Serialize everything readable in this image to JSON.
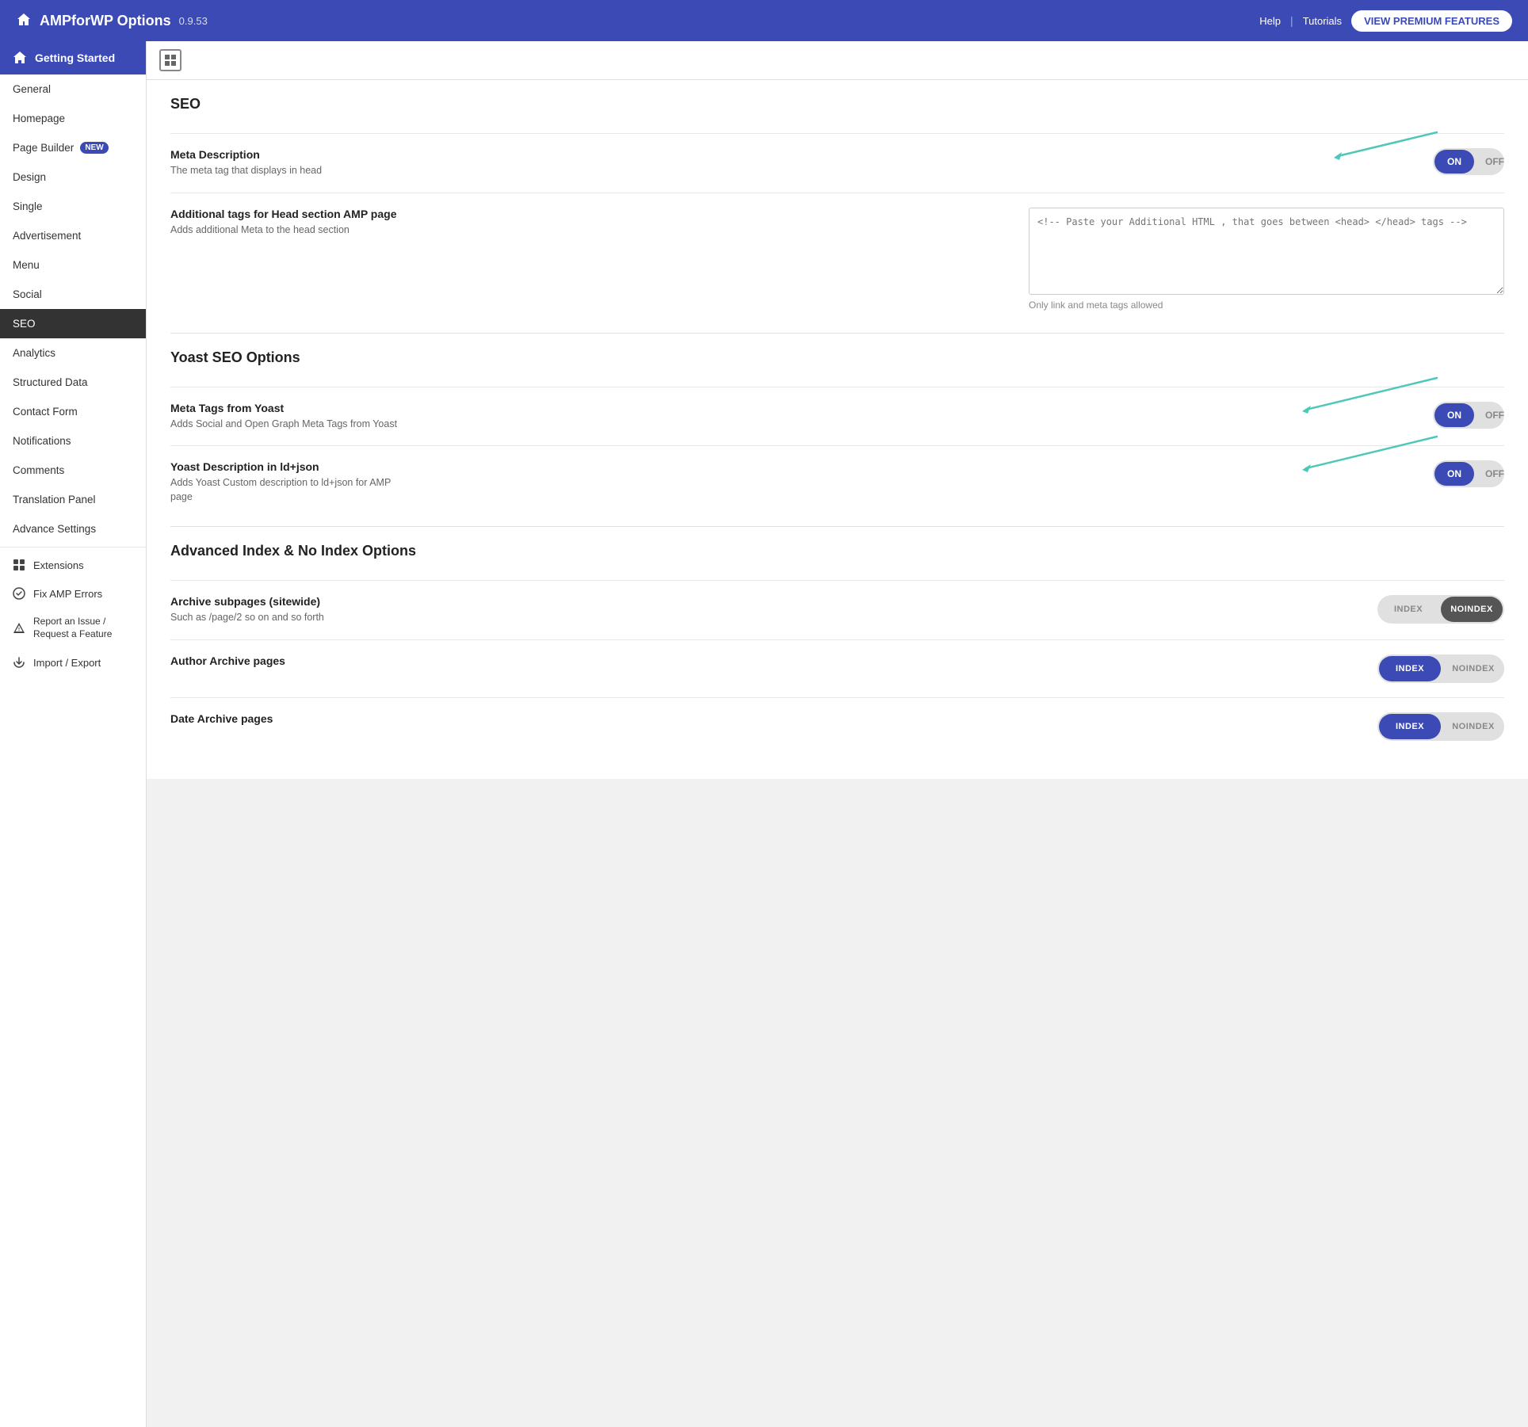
{
  "header": {
    "title": "AMPforWP Options",
    "version": "0.9.53",
    "help_label": "Help",
    "tutorials_label": "Tutorials",
    "premium_btn": "VIEW PREMIUM FEATURES"
  },
  "sidebar": {
    "getting_started": "Getting Started",
    "items": [
      {
        "label": "General",
        "id": "general",
        "active": false
      },
      {
        "label": "Homepage",
        "id": "homepage",
        "active": false
      },
      {
        "label": "Page Builder",
        "id": "page-builder",
        "active": false,
        "badge": "NEW"
      },
      {
        "label": "Design",
        "id": "design",
        "active": false
      },
      {
        "label": "Single",
        "id": "single",
        "active": false
      },
      {
        "label": "Advertisement",
        "id": "advertisement",
        "active": false
      },
      {
        "label": "Menu",
        "id": "menu",
        "active": false
      },
      {
        "label": "Social",
        "id": "social",
        "active": false
      },
      {
        "label": "SEO",
        "id": "seo",
        "active": true
      },
      {
        "label": "Analytics",
        "id": "analytics",
        "active": false
      },
      {
        "label": "Structured Data",
        "id": "structured-data",
        "active": false
      },
      {
        "label": "Contact Form",
        "id": "contact-form",
        "active": false
      },
      {
        "label": "Notifications",
        "id": "notifications",
        "active": false
      },
      {
        "label": "Comments",
        "id": "comments",
        "active": false
      },
      {
        "label": "Translation Panel",
        "id": "translation-panel",
        "active": false
      },
      {
        "label": "Advance Settings",
        "id": "advance-settings",
        "active": false
      }
    ],
    "extensions_label": "Extensions",
    "fix_amp_label": "Fix AMP Errors",
    "report_label": "Report an Issue / Request a Feature",
    "import_label": "Import / Export"
  },
  "main": {
    "seo_section_title": "SEO",
    "meta_description": {
      "label": "Meta Description",
      "desc": "The meta tag that displays in head",
      "state": "on"
    },
    "additional_tags": {
      "label": "Additional tags for Head section AMP page",
      "desc": "Adds additional Meta to the head section",
      "placeholder": "<!-- Paste your Additional HTML , that goes between <head> </head> tags -->",
      "note": "Only link and meta tags allowed"
    },
    "yoast_section_title": "Yoast SEO Options",
    "meta_tags_yoast": {
      "label": "Meta Tags from Yoast",
      "desc": "Adds Social and Open Graph Meta Tags from Yoast",
      "state": "on"
    },
    "yoast_description": {
      "label": "Yoast Description in ld+json",
      "desc": "Adds Yoast Custom description to ld+json for AMP page",
      "state": "on"
    },
    "advanced_index_title": "Advanced Index & No Index Options",
    "archive_subpages": {
      "label": "Archive subpages (sitewide)",
      "desc": "Such as /page/2 so on and so forth",
      "state": "noindex"
    },
    "author_archive": {
      "label": "Author Archive pages",
      "state": "index"
    },
    "date_archive": {
      "label": "Date Archive pages",
      "state": "index"
    }
  }
}
